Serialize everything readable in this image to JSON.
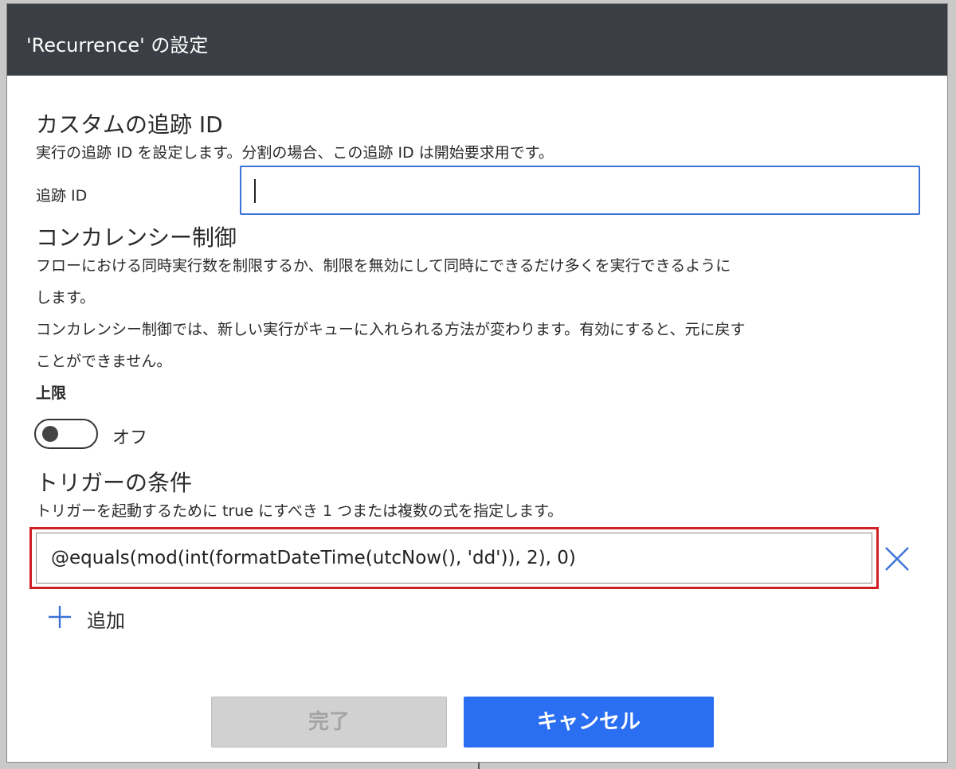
{
  "dialog": {
    "title": "'Recurrence' の設定"
  },
  "tracking": {
    "heading": "カスタムの追跡 ID",
    "description": "実行の追跡 ID を設定します。分割の場合、この追跡 ID は開始要求用です。",
    "field_label": "追跡 ID",
    "field_value": ""
  },
  "concurrency": {
    "heading": "コンカレンシー制御",
    "description_lines": [
      "フローにおける同時実行数を制限するか、制限を無効にして同時にできるだけ多くを実行できるように",
      "します。",
      "コンカレンシー制御では、新しい実行がキューに入れられる方法が変わります。有効にすると、元に戻す",
      "ことができません。"
    ],
    "limit_label": "上限",
    "toggle_state_label": "オフ",
    "toggle_on": false
  },
  "trigger_conditions": {
    "heading": "トリガーの条件",
    "description": "トリガーを起動するために true にすべき 1 つまたは複数の式を指定します。",
    "conditions": [
      "@equals(mod(int(formatDateTime(utcNow(), 'dd')), 2), 0)"
    ],
    "add_label": "追加"
  },
  "footer": {
    "done_label": "完了",
    "cancel_label": "キャンセル"
  },
  "icons": {
    "remove": "close-icon",
    "add": "plus-icon"
  },
  "colors": {
    "titlebar": "#3b3e44",
    "accent_blue": "#2a6ef2",
    "focus_border": "#3b73d6",
    "highlight_red": "#d01f24",
    "disabled_bg": "#d1d1d1",
    "disabled_text": "#a4a4a4"
  }
}
